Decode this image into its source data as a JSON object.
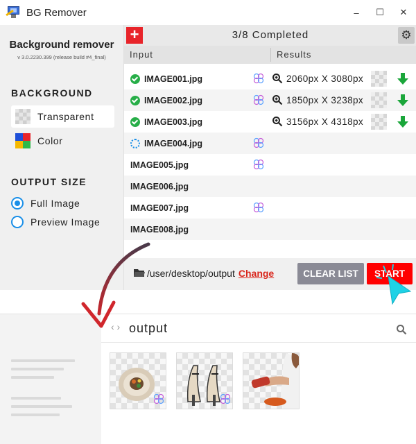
{
  "window": {
    "title": "BG Remover",
    "controls": [
      "–",
      "☐",
      "✕"
    ]
  },
  "sidebar": {
    "app_name": "Background remover",
    "version": "v 3.0.2230.399 (release build #4_final)",
    "background_title": "BACKGROUND",
    "background_options": [
      {
        "label": "Transparent",
        "selected": true
      },
      {
        "label": "Color",
        "selected": false
      }
    ],
    "color_swatch": [
      "#1e4fd8",
      "#e8242a",
      "#f5b800",
      "#2fb84a"
    ],
    "output_title": "OUTPUT SIZE",
    "output_options": [
      {
        "label": "Full Image",
        "selected": true
      },
      {
        "label": "Preview Image",
        "selected": false
      }
    ]
  },
  "queue": {
    "add_label": "+",
    "status": "3/8 Completed",
    "col_input": "Input",
    "col_results": "Results",
    "files": [
      {
        "name": "IMAGE001.jpg",
        "state": "done",
        "ai": true,
        "result": "2060px X 3080px"
      },
      {
        "name": "IMAGE002.jpg",
        "state": "done",
        "ai": true,
        "result": "1850px X 3238px"
      },
      {
        "name": "IMAGE003.jpg",
        "state": "done",
        "ai": false,
        "result": "3156px X 4318px"
      },
      {
        "name": "IMAGE004.jpg",
        "state": "processing",
        "ai": true,
        "result": ""
      },
      {
        "name": "IMAGE005.jpg",
        "state": "pending",
        "ai": true,
        "result": ""
      },
      {
        "name": "IMAGE006.jpg",
        "state": "pending",
        "ai": false,
        "result": ""
      },
      {
        "name": "IMAGE007.jpg",
        "state": "pending",
        "ai": true,
        "result": ""
      },
      {
        "name": "IMAGE008.jpg",
        "state": "pending",
        "ai": false,
        "result": ""
      }
    ],
    "output_path": "/user/desktop/output",
    "change_label": "Change",
    "clear_label": "CLEAR LIST",
    "start_label": "START"
  },
  "explorer": {
    "nav": "‹ ›",
    "folder_title": "output",
    "thumbnails": [
      "plate",
      "sandals",
      "sauce-woman"
    ]
  },
  "colors": {
    "accent_red": "#ff0000",
    "accent_blue": "#1a8fe8",
    "success_green": "#27ae48",
    "cursor_cyan": "#1ed2e6",
    "arrow_dark": "#4a3a4a"
  }
}
